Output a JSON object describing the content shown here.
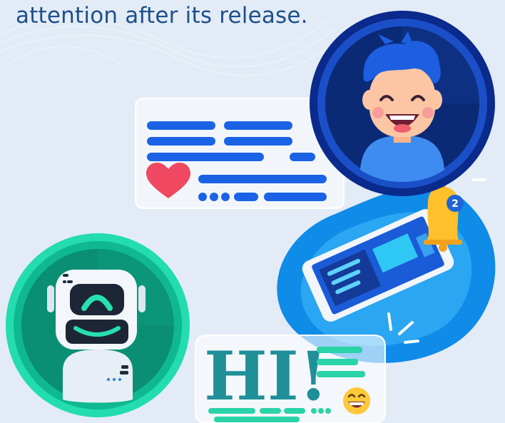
{
  "caption": "attention after its release.",
  "greeting": {
    "text": "HI!"
  },
  "notification": {
    "count": "2"
  },
  "colors": {
    "background": "#e3ecf6",
    "caption_text": "#1e4f8c",
    "user_ring_dark": "#0a2a8c",
    "user_ring_mid": "#1b4fc7",
    "chat_line": "#1a63e6",
    "heart": "#f04860",
    "bot_ring": "#23dcb0",
    "greeting_text": "#1f8f98",
    "bell": "#ffc12b",
    "badge": "#1e63d8",
    "phone_blob": "#0f8be8"
  },
  "icons": [
    "user-avatar",
    "heart-icon",
    "robot-avatar",
    "bell-icon",
    "smartphone",
    "laughing-emoji-icon"
  ]
}
